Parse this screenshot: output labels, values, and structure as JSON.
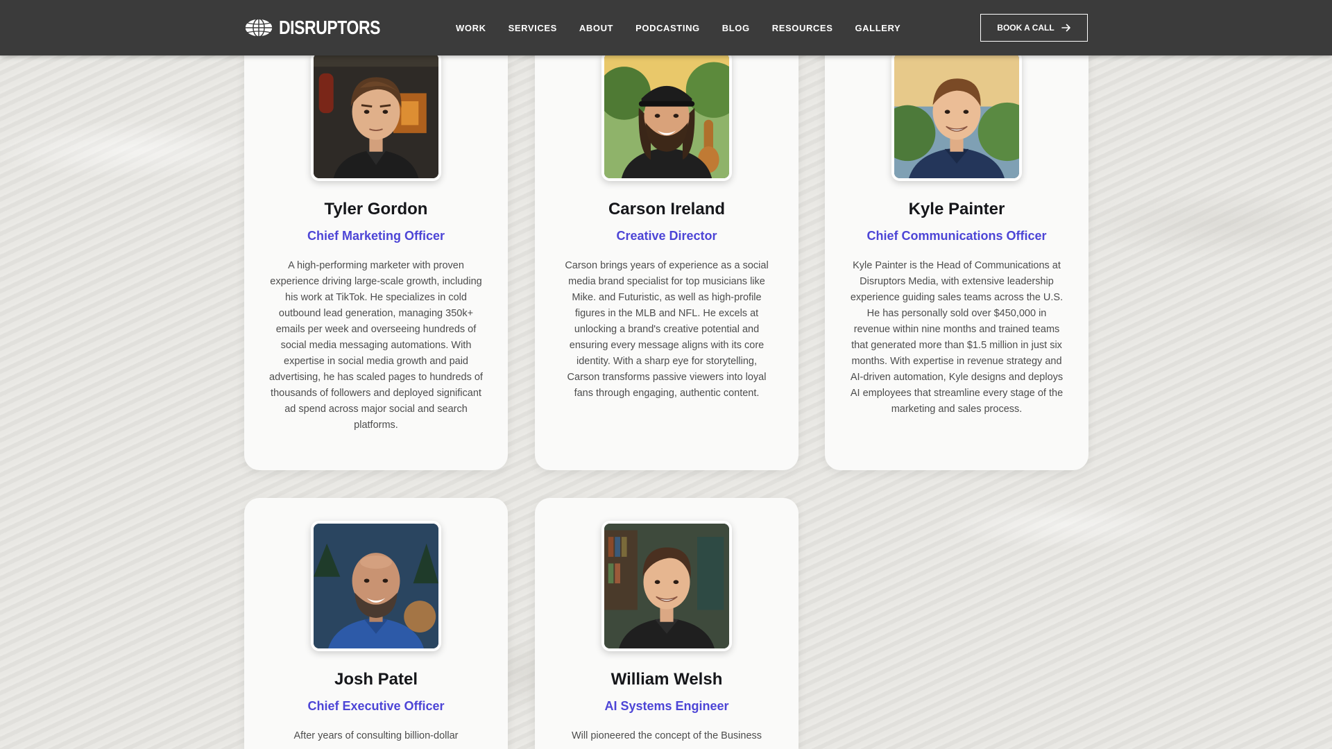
{
  "nav": {
    "logo_text": "DISRUPTORS",
    "links": [
      "WORK",
      "SERVICES",
      "ABOUT",
      "PODCASTING",
      "BLOG",
      "RESOURCES",
      "GALLERY"
    ],
    "cta_label": "BOOK A CALL"
  },
  "team": [
    {
      "name": "Tyler Gordon",
      "role": "Chief Marketing Officer",
      "bio": "A high-performing marketer with proven experience driving large-scale growth, including his work at TikTok. He specializes in cold outbound lead generation, managing 350k+ emails per week and overseeing hundreds of social media messaging automations. With expertise in social media growth and paid advertising, he has scaled pages to hundreds of thousands of followers and deployed significant ad spend across major social and search platforms."
    },
    {
      "name": "Carson Ireland",
      "role": "Creative Director",
      "bio": "Carson brings years of experience as a social media brand specialist for top musicians like Mike. and Futuristic, as well as high-profile figures in the MLB and NFL. He excels at unlocking a brand's creative potential and ensuring every message aligns with its core identity. With a sharp eye for storytelling, Carson transforms passive viewers into loyal fans through engaging, authentic content."
    },
    {
      "name": "Kyle Painter",
      "role": "Chief Communications Officer",
      "bio": "Kyle Painter is the Head of Communications at Disruptors Media, with extensive leadership experience guiding sales teams across the U.S. He has personally sold over $450,000 in revenue within nine months and trained teams that generated more than $1.5 million in just six months. With expertise in revenue strategy and AI-driven automation, Kyle designs and deploys AI employees that streamline every stage of the marketing and sales process."
    },
    {
      "name": "Josh Patel",
      "role": "Chief Executive Officer",
      "bio": "After years of consulting billion-dollar"
    },
    {
      "name": "William Welsh",
      "role": "AI Systems Engineer",
      "bio": "Will pioneered the concept of the Business"
    }
  ],
  "colors": {
    "nav_bg": "#3b3b3b",
    "role_accent": "#4d45d6",
    "card_bg": "#fafaf9",
    "page_bg": "#e6e5e1"
  },
  "icons": {
    "logo": "globe-icon",
    "cta": "arrow-right-icon"
  }
}
